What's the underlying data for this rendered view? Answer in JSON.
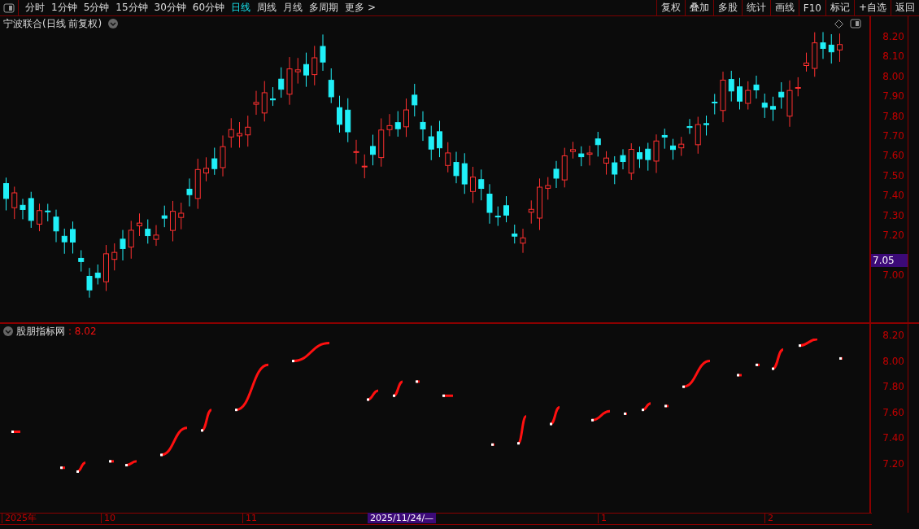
{
  "toolbar": {
    "periods": [
      {
        "label": "分时",
        "selected": false
      },
      {
        "label": "1分钟",
        "selected": false
      },
      {
        "label": "5分钟",
        "selected": false
      },
      {
        "label": "15分钟",
        "selected": false
      },
      {
        "label": "30分钟",
        "selected": false
      },
      {
        "label": "60分钟",
        "selected": false
      },
      {
        "label": "日线",
        "selected": true
      },
      {
        "label": "周线",
        "selected": false
      },
      {
        "label": "月线",
        "selected": false
      },
      {
        "label": "多周期",
        "selected": false
      }
    ],
    "more": "更多 >",
    "buttons": [
      "复权",
      "叠加",
      "多股",
      "统计",
      "画线",
      "F10",
      "标记",
      "+自选",
      "返回"
    ]
  },
  "main_chart": {
    "title": "宁波联合(日线 前复权)",
    "price_axis": [
      "8.20",
      "8.10",
      "8.00",
      "7.90",
      "7.80",
      "7.70",
      "7.60",
      "7.50",
      "7.40",
      "7.30",
      "7.20",
      "7.00"
    ],
    "price_tag": "7.05"
  },
  "indicator": {
    "name": "股朋指标网",
    "value": ": 8.02",
    "axis": [
      "8.20",
      "8.00",
      "7.80",
      "7.60",
      "7.40",
      "7.20"
    ]
  },
  "time_axis": {
    "labels": [
      "2025年",
      "10",
      "11",
      "1",
      "2"
    ],
    "cursor_date": "2025/11/24/—"
  }
}
